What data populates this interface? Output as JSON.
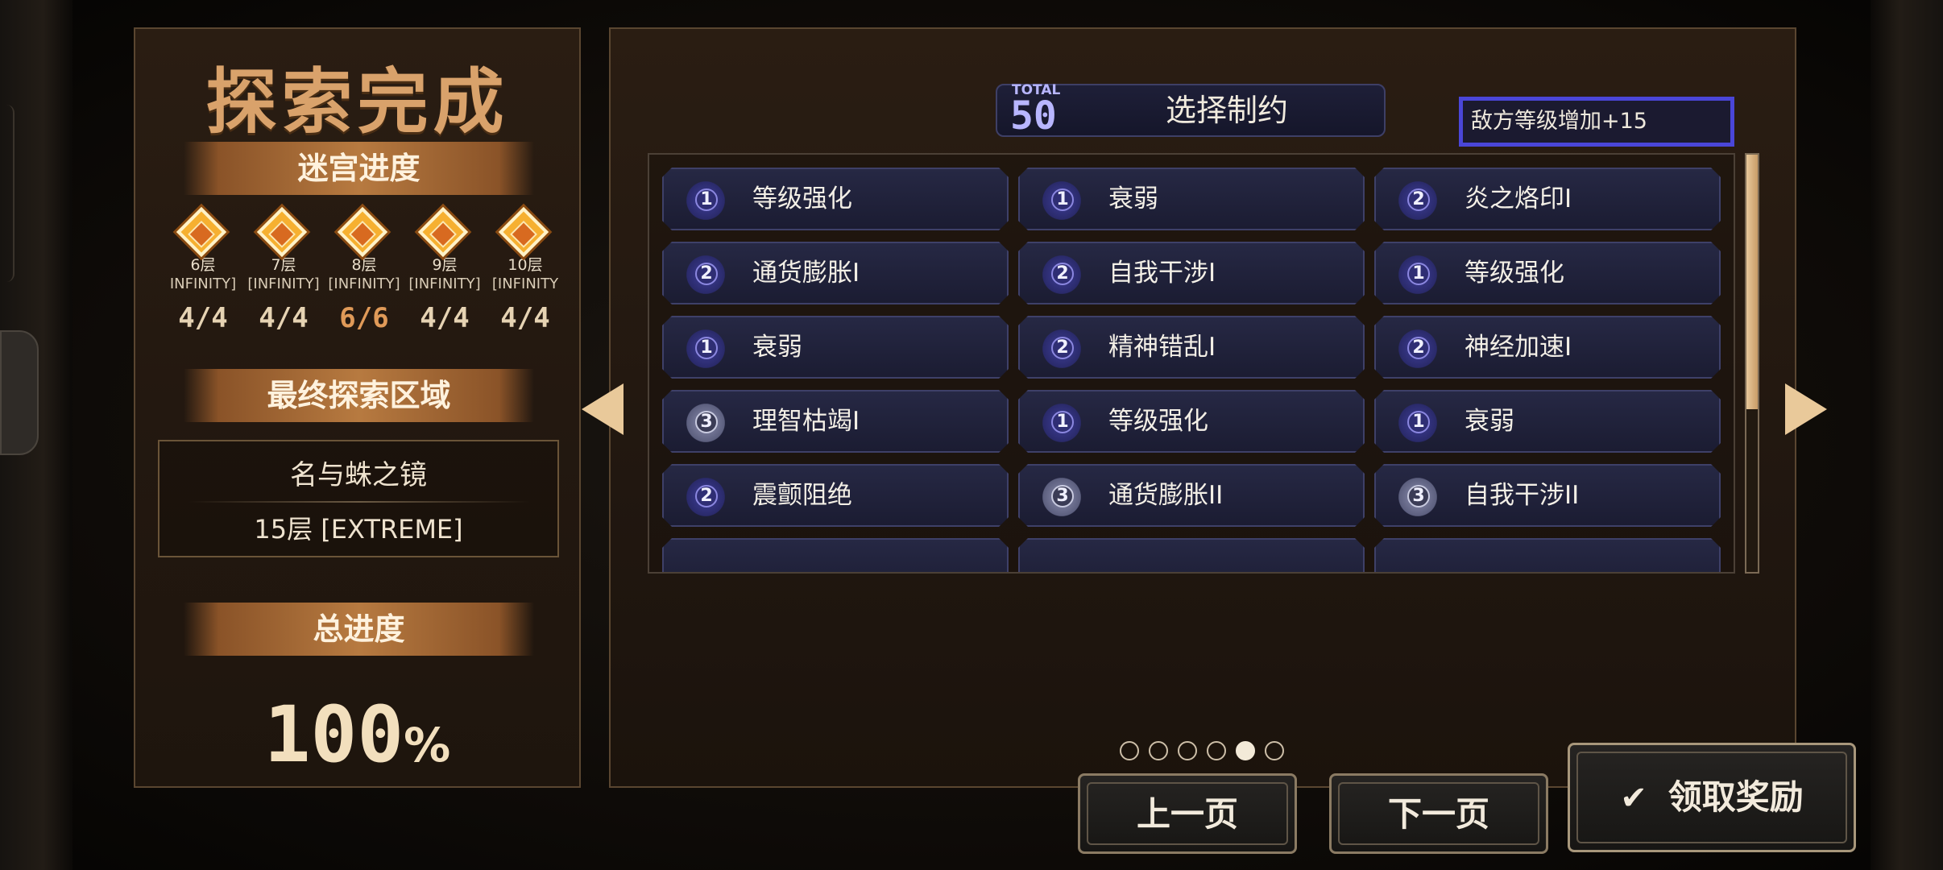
{
  "left": {
    "title": "探索完成",
    "labyrinth_header": "迷宫进度",
    "floors": [
      {
        "floor": "6层",
        "mode": "INFINITY]",
        "count": "4/4"
      },
      {
        "floor": "7层",
        "mode": "[INFINITY]",
        "count": "4/4"
      },
      {
        "floor": "8层",
        "mode": "[INFINITY]",
        "count": "6/6"
      },
      {
        "floor": "9层",
        "mode": "[INFINITY]",
        "count": "4/4"
      },
      {
        "floor": "10层",
        "mode": "[INFINITY",
        "count": "4/4"
      }
    ],
    "final_area_header": "最终探索区域",
    "final_area_name": "名与蛛之镜",
    "final_area_floor": "15层 [EXTREME]",
    "total_header": "总进度",
    "total_value": "100",
    "total_unit": "%"
  },
  "header": {
    "total_label": "TOTAL",
    "total_value": "50",
    "title": "选择制约",
    "enemy_level": "敌方等级增加+15"
  },
  "constraints": [
    {
      "level": "1",
      "label": "等级强化"
    },
    {
      "level": "1",
      "label": "衰弱"
    },
    {
      "level": "2",
      "label": "炎之烙印I"
    },
    {
      "level": "2",
      "label": "通货膨胀I"
    },
    {
      "level": "2",
      "label": "自我干涉I"
    },
    {
      "level": "1",
      "label": "等级强化"
    },
    {
      "level": "1",
      "label": "衰弱"
    },
    {
      "level": "2",
      "label": "精神错乱I"
    },
    {
      "level": "2",
      "label": "神经加速I"
    },
    {
      "level": "3",
      "label": "理智枯竭I"
    },
    {
      "level": "1",
      "label": "等级强化"
    },
    {
      "level": "1",
      "label": "衰弱"
    },
    {
      "level": "2",
      "label": "震颤阻绝"
    },
    {
      "level": "3",
      "label": "通货膨胀II"
    },
    {
      "level": "3",
      "label": "自我干涉II"
    }
  ],
  "pagination": {
    "total_pages": 6,
    "active_index": 4
  },
  "buttons": {
    "prev": "上一页",
    "next": "下一页",
    "claim": "领取奖励",
    "claim_icon": "✔"
  },
  "colors": {
    "accent_text": "#d9a26b",
    "card_bg": "#1f2038",
    "enemy_box_border": "#4a46d8"
  },
  "icons": [
    "arrow-left-icon",
    "arrow-right-icon",
    "check-icon",
    "diamond-floor-icon",
    "level-badge-icon"
  ]
}
